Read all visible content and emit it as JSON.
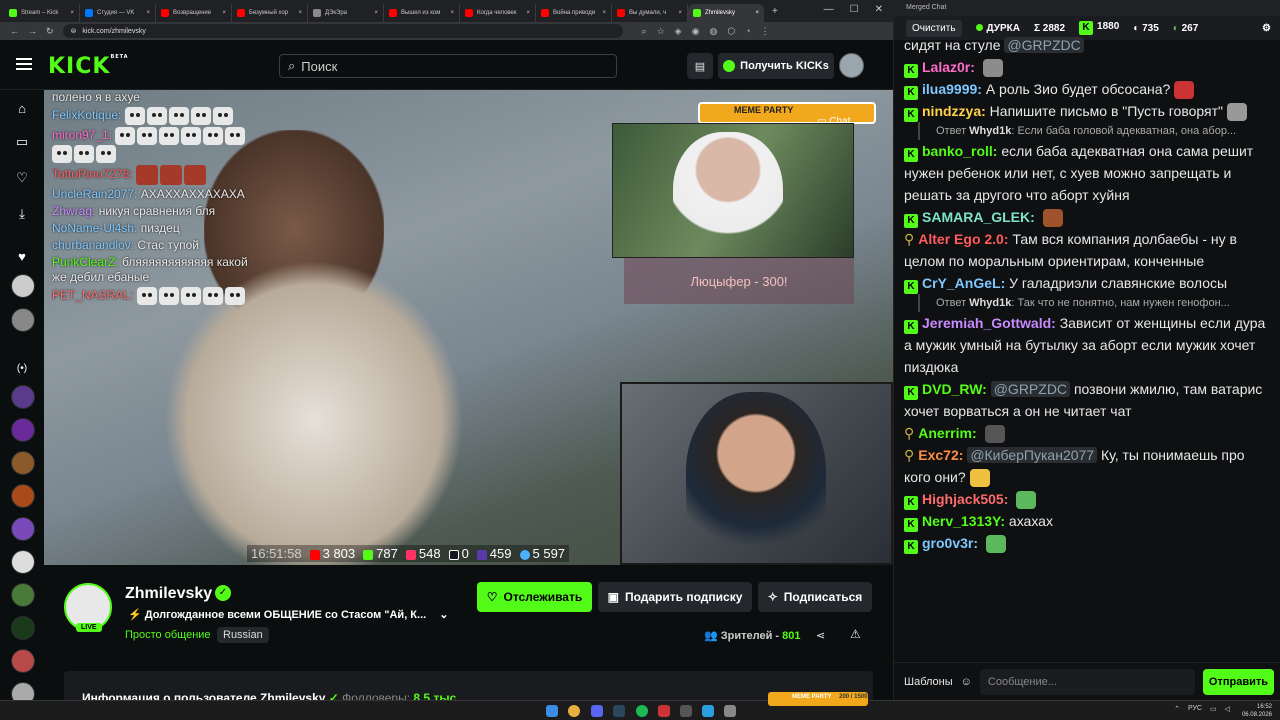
{
  "browser": {
    "tabs": [
      {
        "label": "Stream – Kick",
        "color": "#53fc18",
        "active": false
      },
      {
        "label": "Студия — VK",
        "color": "#0077ff",
        "active": false
      },
      {
        "label": "Возвращение",
        "color": "#ff0000",
        "active": false
      },
      {
        "label": "Безумный хор",
        "color": "#ff0000",
        "active": false
      },
      {
        "label": "ДЭкЭра",
        "color": "#8a8a8a",
        "active": false
      },
      {
        "label": "Вышел из ком",
        "color": "#ff0000",
        "active": false
      },
      {
        "label": "Когда человек",
        "color": "#ff0000",
        "active": false
      },
      {
        "label": "Война приводи",
        "color": "#ff0000",
        "active": false
      },
      {
        "label": "Вы думали, ч",
        "color": "#ff0000",
        "active": false
      },
      {
        "label": "Zhmilevsky",
        "color": "#53fc18",
        "active": true
      }
    ],
    "url": "kick.com/zhmilevsky"
  },
  "header": {
    "logo": "KICK",
    "logo_badge": "BETA",
    "search_placeholder": "Поиск",
    "get_kicks_label": "Получить KICKs"
  },
  "video": {
    "overlay_chat": [
      {
        "user": "",
        "text": "полено я в ахуе",
        "color": "#ffffff"
      },
      {
        "user": "FelixKotique:",
        "text": "",
        "color": "#7ec8ff",
        "emotes": 5
      },
      {
        "user": "miron97_1:",
        "text": "",
        "color": "#ff6bcb",
        "emotes": 9
      },
      {
        "user": "TottoRino7278:",
        "text": "",
        "color": "#ff5c5c",
        "red_emotes": 3
      },
      {
        "user": "UncleRain2077:",
        "text": "АХАХХАХХАХАХА",
        "color": "#7ec8ff"
      },
      {
        "user": "Zhwrag:",
        "text": "никуя сравнения бля",
        "color": "#c88bff"
      },
      {
        "user": "NoName-Ul4sh:",
        "text": "пиздец",
        "color": "#7ec8ff"
      },
      {
        "user": "churbanandlov:",
        "text": "Стас тупой",
        "color": "#7ec8ff"
      },
      {
        "user": "PunkClearZ:",
        "text": "бляяяяяяяяяяяя какой же дебил ебаные",
        "color": "#53fc18"
      },
      {
        "user": "PET_NASRAL:",
        "text": "",
        "color": "#ff6b6b",
        "emotes": 5
      }
    ],
    "meme_party_label": "MEME PARTY",
    "chat_label": "Chat",
    "pip_caption": "Люцыфер - 300!",
    "stats": {
      "time": "16:51:58",
      "youtube": "3 803",
      "kick": "787",
      "vk": "548",
      "rutube": "0",
      "trovo": "459",
      "total": "5 597"
    }
  },
  "stream": {
    "channel_name": "Zhmilevsky",
    "title": "Долгожданное всеми ОБЩЕНИЕ со Стасом \"Ай, К...",
    "category": "Просто общение",
    "language": "Russian",
    "live_label": "LIVE",
    "follow_label": "Отслеживать",
    "gift_label": "Подарить подписку",
    "subscribe_label": "Подписаться",
    "viewers_label": "Зрителей - ",
    "viewers_count": "801",
    "about_prefix": "Информация о пользователе Zhmilevsky",
    "followers_label": "Фолловеры:",
    "followers_count": "8.5 тыс"
  },
  "chat": {
    "window_title": "Merged Chat",
    "clear_label": "Очистить",
    "header_name": "ДУРКА",
    "counts": {
      "sigma": "Σ 2882",
      "kick": "1880",
      "other1": "735",
      "other2": "267"
    },
    "messages": [
      {
        "kind": "msg",
        "badge": "none",
        "user": "",
        "user_color": "#e8e8e8",
        "mention": "@GRPZDC",
        "text": "сидят на стуле",
        "emote_color": ""
      },
      {
        "kind": "msg",
        "badge": "kick",
        "user": "Lalaz0r:",
        "user_color": "#ff6bcb",
        "mention": "",
        "text": "",
        "emote_color": "#8c8c8c"
      },
      {
        "kind": "msg",
        "badge": "kick",
        "user": "ilua9999:",
        "user_color": "#7ec8ff",
        "mention": "",
        "text": "А роль Зио будет обсосана?",
        "emote_color": "#c33"
      },
      {
        "kind": "msg",
        "badge": "kick",
        "user": "nindzzya:",
        "user_color": "#ffd24a",
        "mention": "",
        "text": "Напишите письмо в \"Пусть говорят\"",
        "emote_color": "#999"
      },
      {
        "kind": "reply",
        "reply_user": "Whyd1k",
        "text": "Если баба головой адекватная, она абор..."
      },
      {
        "kind": "msg",
        "badge": "kick",
        "user": "banko_roll:",
        "user_color": "#53fc18",
        "mention": "",
        "text": "если баба адекватная она сама решит нужен ребенок или нет, с хуев можно запрещать и решать за другого что аборт хуйня",
        "emote_color": ""
      },
      {
        "kind": "msg",
        "badge": "kick",
        "user": "SAMARA_GLEK:",
        "user_color": "#7ee3c8",
        "mention": "",
        "text": "",
        "emote_color": "#a0522d"
      },
      {
        "kind": "msg",
        "badge": "rust",
        "user": "Alter Ego 2.0:",
        "user_color": "#ff5c5c",
        "mention": "",
        "text": "Там вся компания долбаебы - ну в целом по моральным ориентирам, конченные",
        "emote_color": ""
      },
      {
        "kind": "msg",
        "badge": "kick",
        "user": "CrY_AnGeL:",
        "user_color": "#7ec8ff",
        "mention": "",
        "text": "У галадриэли славянские волосы",
        "emote_color": ""
      },
      {
        "kind": "reply",
        "reply_user": "Whyd1k",
        "text": "Так что не понятно, нам нужен генофон..."
      },
      {
        "kind": "msg",
        "badge": "kick",
        "user": "Jeremiah_Gottwald:",
        "user_color": "#c88bff",
        "mention": "",
        "text": "Зависит от женщины если дура а мужик умный на бутылку за аборт если мужик хочет пиздюка",
        "emote_color": ""
      },
      {
        "kind": "msg",
        "badge": "kick",
        "user": "DVD_RW:",
        "user_color": "#53fc18",
        "mention": "@GRPZDC",
        "text": "позвони жмилю, там ватарис хочет ворваться а он не читает чат",
        "emote_color": ""
      },
      {
        "kind": "msg",
        "badge": "rust",
        "user": "Anerrim:",
        "user_color": "#53fc18",
        "mention": "",
        "text": "",
        "emote_color": "#555"
      },
      {
        "kind": "msg",
        "badge": "rust",
        "user": "Exc72:",
        "user_color": "#ff8c42",
        "mention": "@КиберПукан2077",
        "text": "Ку, ты понимаешь про кого они?",
        "emote_color": "#f0c040"
      },
      {
        "kind": "msg",
        "badge": "kick",
        "user": "Highjack505:",
        "user_color": "#ff6b6b",
        "mention": "",
        "text": "",
        "emote_color": "#5cb85c"
      },
      {
        "kind": "msg",
        "badge": "kick",
        "user": "Nerv_1313Y:",
        "user_color": "#53fc18",
        "mention": "",
        "text": "ахахах",
        "emote_color": ""
      },
      {
        "kind": "msg",
        "badge": "kick",
        "user": "gro0v3r:",
        "user_color": "#7ec8ff",
        "mention": "",
        "text": "",
        "emote_color": "#5cb85c"
      }
    ],
    "templates_label": "Шаблоны",
    "input_placeholder": "Сообщение...",
    "send_label": "Отправить"
  },
  "taskbar": {
    "lang": "РУС",
    "time": "16:52",
    "date": "06.08.2026",
    "meme_widget": "MEME PARTY",
    "meme_counter": "200 / 1500"
  }
}
